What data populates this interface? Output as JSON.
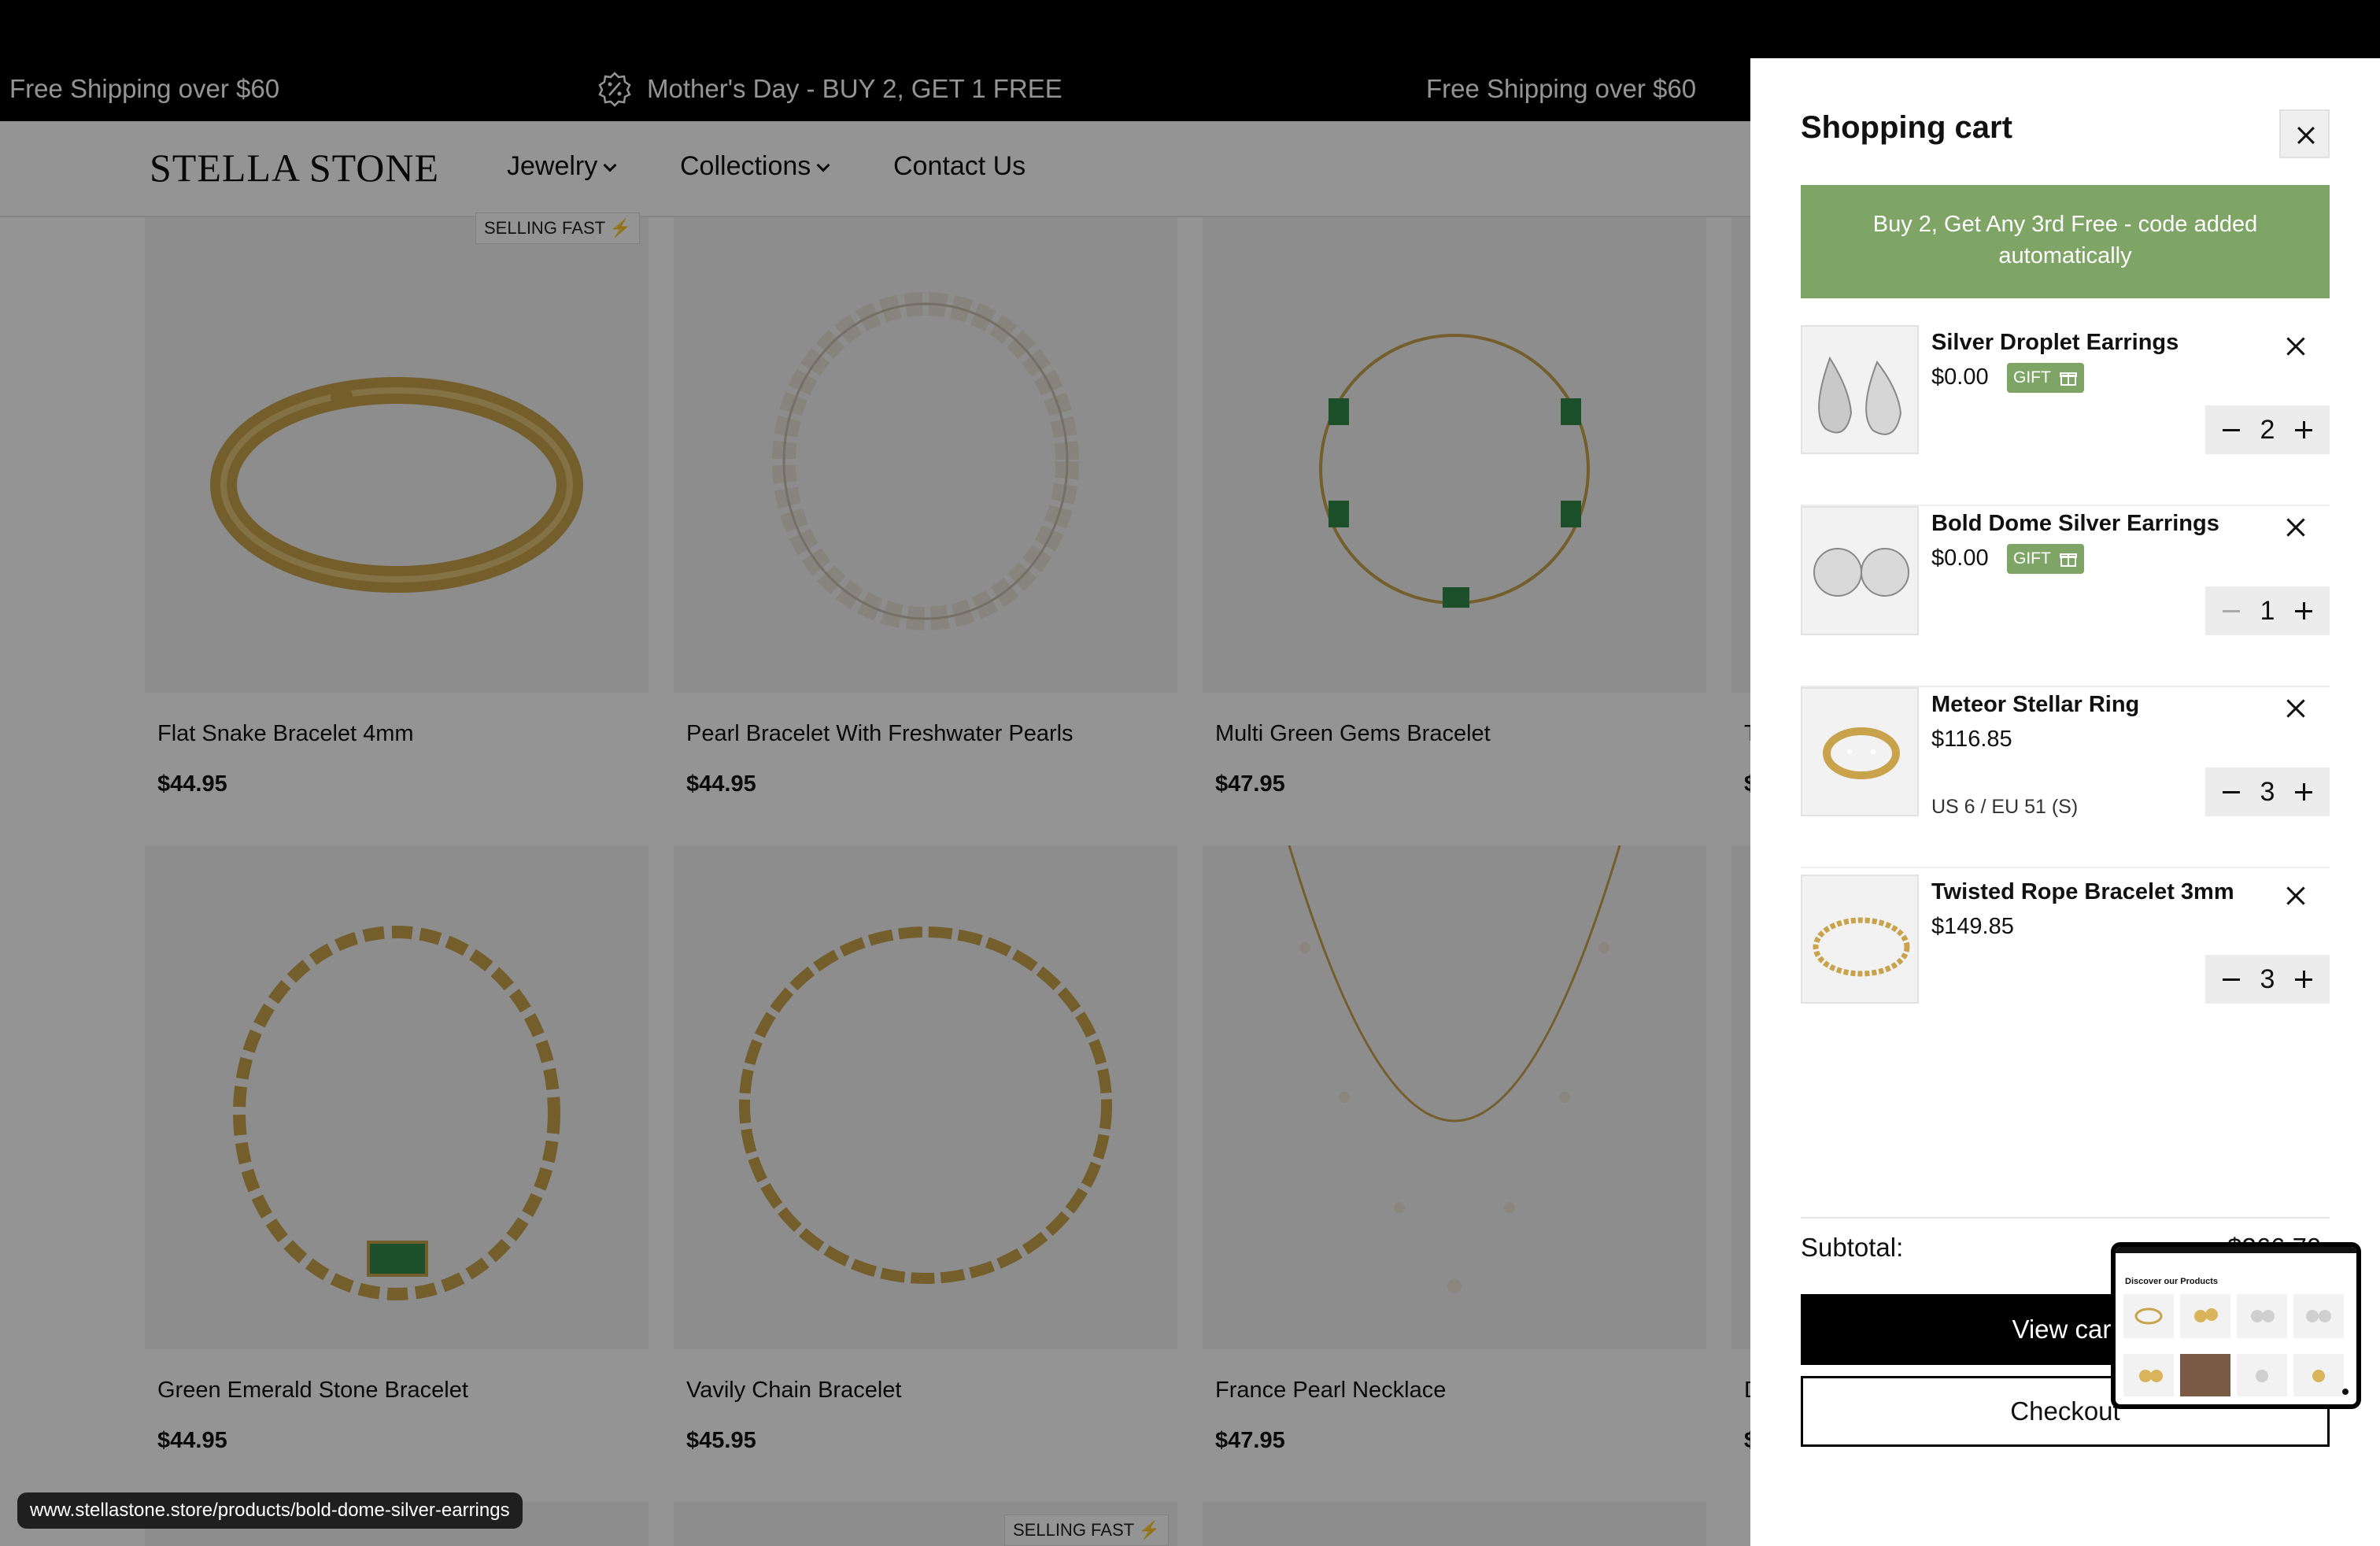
{
  "announcement": {
    "left": "Free Shipping over $60",
    "center": "Mother's Day - BUY 2, GET 1 FREE",
    "right": "Free Shipping over $60"
  },
  "header": {
    "logo": "STELLA STONE",
    "nav": [
      "Jewelry",
      "Collections",
      "Contact Us"
    ]
  },
  "products": {
    "row1": [
      {
        "name": "Flat Snake Bracelet 4mm",
        "price": "$44.95",
        "badge": "SELLING FAST"
      },
      {
        "name": "Pearl Bracelet With Freshwater Pearls",
        "price": "$44.95"
      },
      {
        "name": "Multi Green Gems Bracelet",
        "price": "$47.95"
      },
      {
        "name": "T",
        "price": "$"
      }
    ],
    "row2": [
      {
        "name": "Green Emerald Stone Bracelet",
        "price": "$44.95"
      },
      {
        "name": "Vavily Chain Bracelet",
        "price": "$45.95"
      },
      {
        "name": "France Pearl Necklace",
        "price": "$47.95"
      },
      {
        "name": "D",
        "price": "$"
      }
    ],
    "row3_badge": "SELLING FAST"
  },
  "status_url": "www.stellastone.store/products/bold-dome-silver-earrings",
  "cart": {
    "title": "Shopping cart",
    "promo": "Buy 2, Get Any 3rd Free - code added automatically",
    "gift_label": "GIFT",
    "items": [
      {
        "name": "Silver Droplet Earrings",
        "price": "$0.00",
        "gift": true,
        "qty": "2",
        "variant": ""
      },
      {
        "name": "Bold Dome Silver Earrings",
        "price": "$0.00",
        "gift": true,
        "qty": "1",
        "variant": ""
      },
      {
        "name": "Meteor Stellar Ring",
        "price": "$116.85",
        "gift": false,
        "qty": "3",
        "variant": "US 6 / EU 51 (S)"
      },
      {
        "name": "Twisted Rope Bracelet 3mm",
        "price": "$149.85",
        "gift": false,
        "qty": "3",
        "variant": ""
      }
    ],
    "subtotal_label": "Subtotal:",
    "subtotal_value": "$266.70",
    "view_cart": "View cart",
    "checkout": "Checkout"
  },
  "mini_preview": {
    "title": "Discover our Products"
  },
  "colors": {
    "promo_green": "#7ea566",
    "overlay": "rgba(0,0,0,0.42)",
    "button_black": "#000000"
  }
}
